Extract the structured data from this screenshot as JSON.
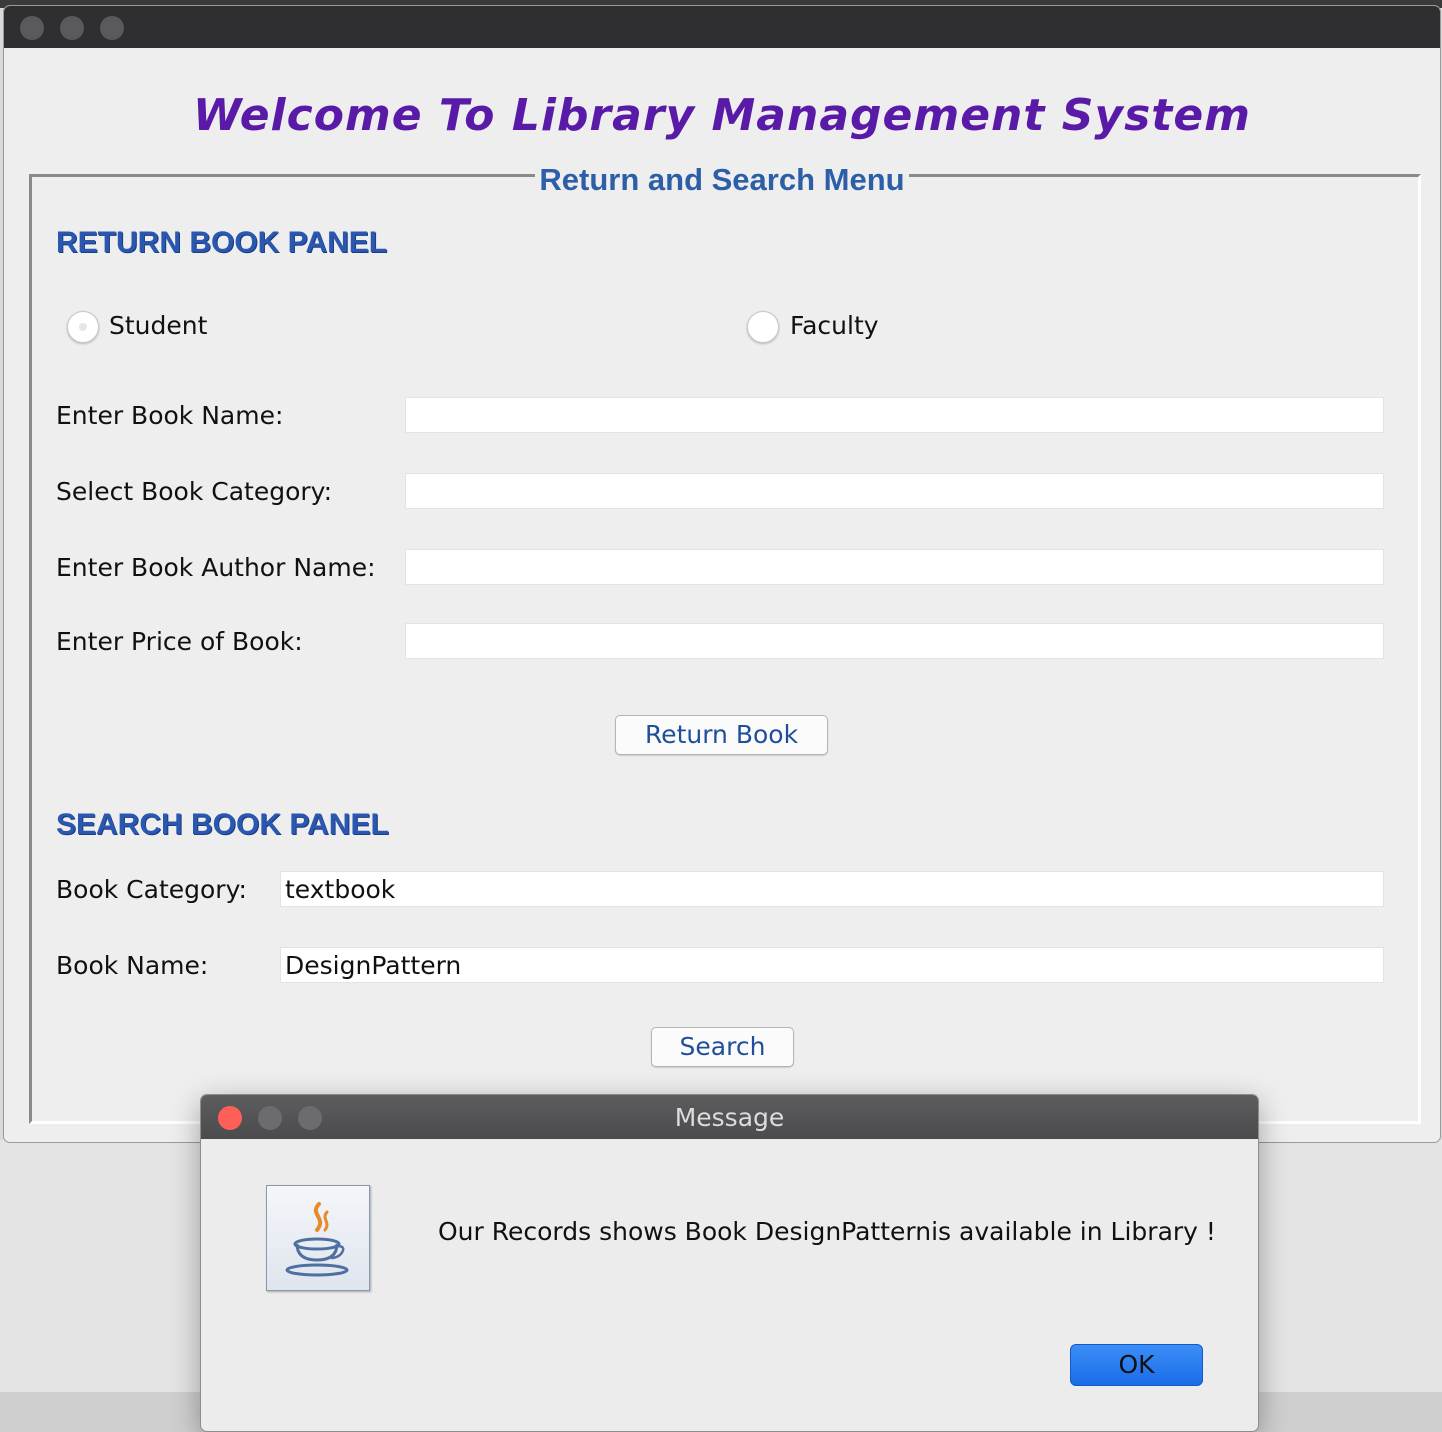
{
  "window": {
    "welcome_title": "Welcome To Library Management System",
    "menu_title": "Return and Search Menu"
  },
  "return_panel": {
    "heading": "RETURN BOOK PANEL",
    "radio_options": [
      {
        "label": "Student",
        "selected": true
      },
      {
        "label": "Faculty",
        "selected": false
      }
    ],
    "fields": [
      {
        "label": "Enter Book Name:",
        "value": ""
      },
      {
        "label": "Select Book Category:",
        "value": ""
      },
      {
        "label": "Enter Book Author Name:",
        "value": ""
      },
      {
        "label": "Enter Price of Book:",
        "value": ""
      }
    ],
    "button_label": "Return Book"
  },
  "search_panel": {
    "heading": "SEARCH BOOK PANEL",
    "fields": [
      {
        "label": "Book Category:",
        "value": "textbook"
      },
      {
        "label": "Book Name:",
        "value": "DesignPattern"
      }
    ],
    "button_label": "Search"
  },
  "dialog": {
    "title": "Message",
    "message": "Our Records shows Book DesignPatternis available in Library !",
    "ok_label": "OK",
    "icon": "java-icon"
  },
  "colors": {
    "welcome": "#5a1aa8",
    "panel_heading": "#2a57b0",
    "button_text": "#1f4f9a",
    "ok_button": "#1a6ce8",
    "close_button": "#fe5f57"
  }
}
